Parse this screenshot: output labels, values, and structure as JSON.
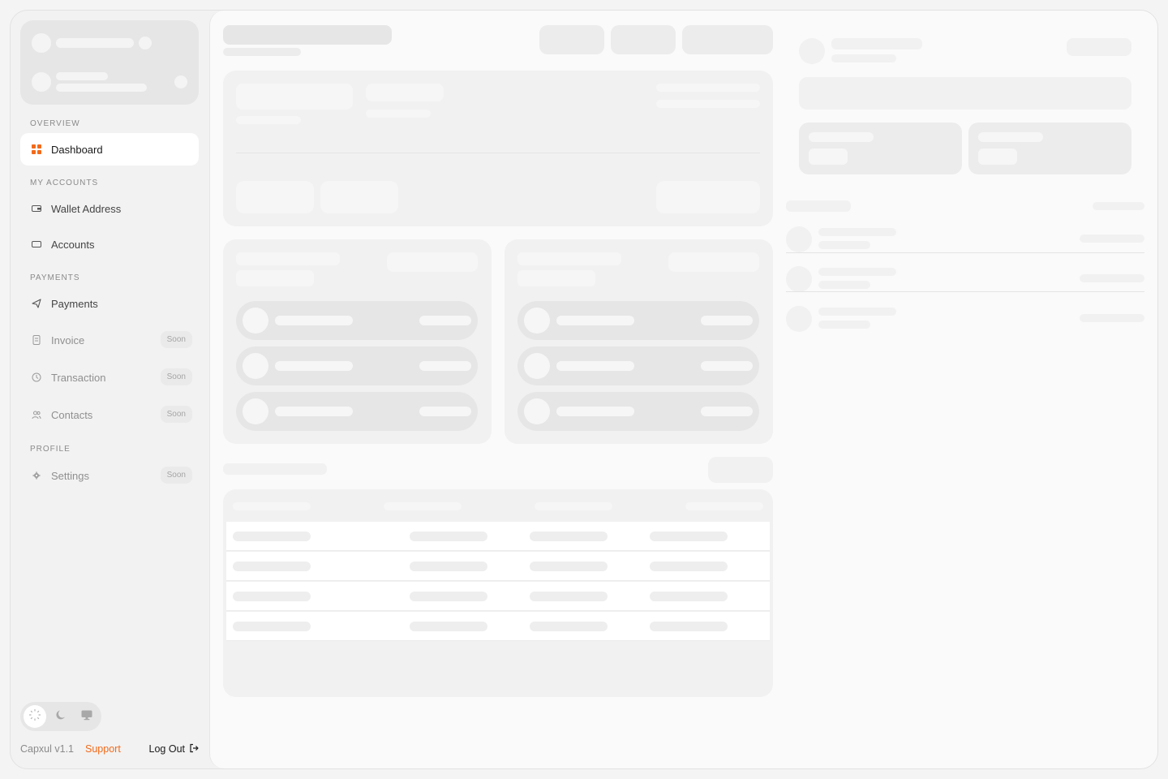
{
  "sidebar": {
    "sections": {
      "overview": "OVERVIEW",
      "my_accounts": "MY ACCOUNTS",
      "payments": "PAYMENTS",
      "profile": "PROFILE"
    },
    "items": {
      "dashboard": "Dashboard",
      "wallet_address": "Wallet Address",
      "accounts": "Accounts",
      "payments": "Payments",
      "invoice": "Invoice",
      "transaction": "Transaction",
      "contacts": "Contacts",
      "settings": "Settings"
    },
    "soon_badge": "Soon"
  },
  "footer": {
    "version": "Capxul v1.1",
    "support": "Support",
    "logout": "Log Out"
  },
  "colors": {
    "accent": "#f26a1b"
  },
  "icons": {
    "dashboard": "grid-icon",
    "wallet_address": "wallet-icon",
    "accounts": "card-icon",
    "payments": "send-icon",
    "invoice": "document-icon",
    "transaction": "history-icon",
    "contacts": "users-icon",
    "settings": "gear-icon",
    "theme_light": "sun-icon",
    "theme_dark": "moon-icon",
    "theme_system": "monitor-icon",
    "logout": "logout-icon"
  }
}
